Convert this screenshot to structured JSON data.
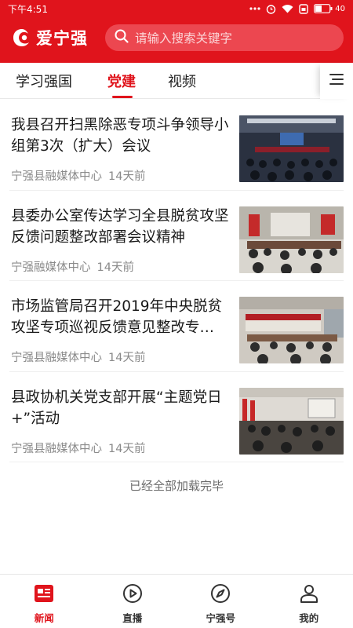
{
  "status_bar": {
    "time": "下午4:51",
    "battery": "40"
  },
  "app": {
    "logo_text": "爱宁强"
  },
  "search": {
    "placeholder": "请输入搜索关键字"
  },
  "tabs": [
    {
      "label": "学习强国",
      "active": false
    },
    {
      "label": "党建",
      "active": true
    },
    {
      "label": "视频",
      "active": false
    }
  ],
  "news": [
    {
      "title": "我县召开扫黑除恶专项斗争领导小组第3次（扩大）会议",
      "source": "宁强县融媒体中心",
      "time": "14天前"
    },
    {
      "title": "县委办公室传达学习全县脱贫攻坚反馈问题整改部署会议精神",
      "source": "宁强融媒体中心",
      "time": "14天前"
    },
    {
      "title": "市场监管局召开2019年中央脱贫攻坚专项巡视反馈意见整改专…",
      "source": "宁强县融媒体中心",
      "time": "14天前"
    },
    {
      "title": "县政协机关党支部开展“主题党日+”活动",
      "source": "宁强县融媒体中心",
      "time": "14天前"
    }
  ],
  "end_note": "已经全部加载完毕",
  "bottom_nav": [
    {
      "label": "新闻",
      "icon": "news-icon",
      "active": true
    },
    {
      "label": "直播",
      "icon": "play-icon",
      "active": false
    },
    {
      "label": "宁强号",
      "icon": "compass-icon",
      "active": false
    },
    {
      "label": "我的",
      "icon": "user-icon",
      "active": false
    }
  ],
  "colors": {
    "brand_red": "#e0141c",
    "text_primary": "#1a1a1a",
    "text_meta": "#8a8a8a"
  }
}
